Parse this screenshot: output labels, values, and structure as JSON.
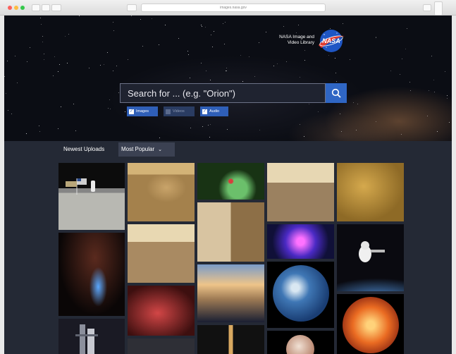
{
  "browser": {
    "url_text": "images.nasa.gov"
  },
  "header": {
    "logo_line1": "NASA Image and",
    "logo_line2": "Video Library",
    "logo_badge": "NASA"
  },
  "search": {
    "placeholder": "Search for ... (e.g. \"Orion\")"
  },
  "filters": [
    {
      "label": "Images",
      "checked": true
    },
    {
      "label": "Videos",
      "checked": false
    },
    {
      "label": "Audio",
      "checked": true
    }
  ],
  "tabs": {
    "newest": "Newest Uploads",
    "popular": "Most Popular",
    "selected": "popular"
  },
  "colors": {
    "accent": "#2f66c4",
    "page_bg": "#242935",
    "hero_bg": "#0b0d14"
  },
  "gallery": [
    "moon-walk-flag",
    "mars-rover-rocks",
    "infrared-nebula",
    "mars-landscape",
    "gold-foil",
    "shuttle-launch-night",
    "mars-dune",
    "mars-outcrop",
    "milky-way-center",
    "astronaut-spacewalk",
    "red-nebula",
    "jupiter",
    "blue-marble-earth",
    "solar-flare-sun",
    "iss",
    "launch-beam",
    "rocket-tower",
    "pluto"
  ]
}
